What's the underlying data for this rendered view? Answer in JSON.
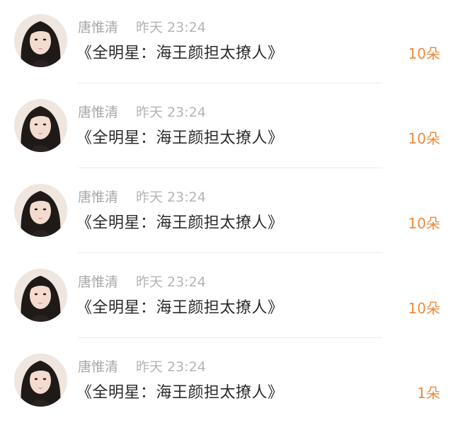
{
  "colors": {
    "name": "#a8a8a8",
    "time": "#b4b4b4",
    "message": "#2a2a2a",
    "accent": "#ee8a3c"
  },
  "messages": [
    {
      "user": "唐惟清",
      "time": "昨天 23:24",
      "text": "《全明星：海王颜担太撩人》",
      "gift": "10朵"
    },
    {
      "user": "唐惟清",
      "time": "昨天 23:24",
      "text": "《全明星：海王颜担太撩人》",
      "gift": "10朵"
    },
    {
      "user": "唐惟清",
      "time": "昨天 23:24",
      "text": "《全明星：海王颜担太撩人》",
      "gift": "10朵"
    },
    {
      "user": "唐惟清",
      "time": "昨天 23:24",
      "text": "《全明星：海王颜担太撩人》",
      "gift": "10朵"
    },
    {
      "user": "唐惟清",
      "time": "昨天 23:24",
      "text": "《全明星：海王颜担太撩人》",
      "gift": "1朵"
    }
  ]
}
